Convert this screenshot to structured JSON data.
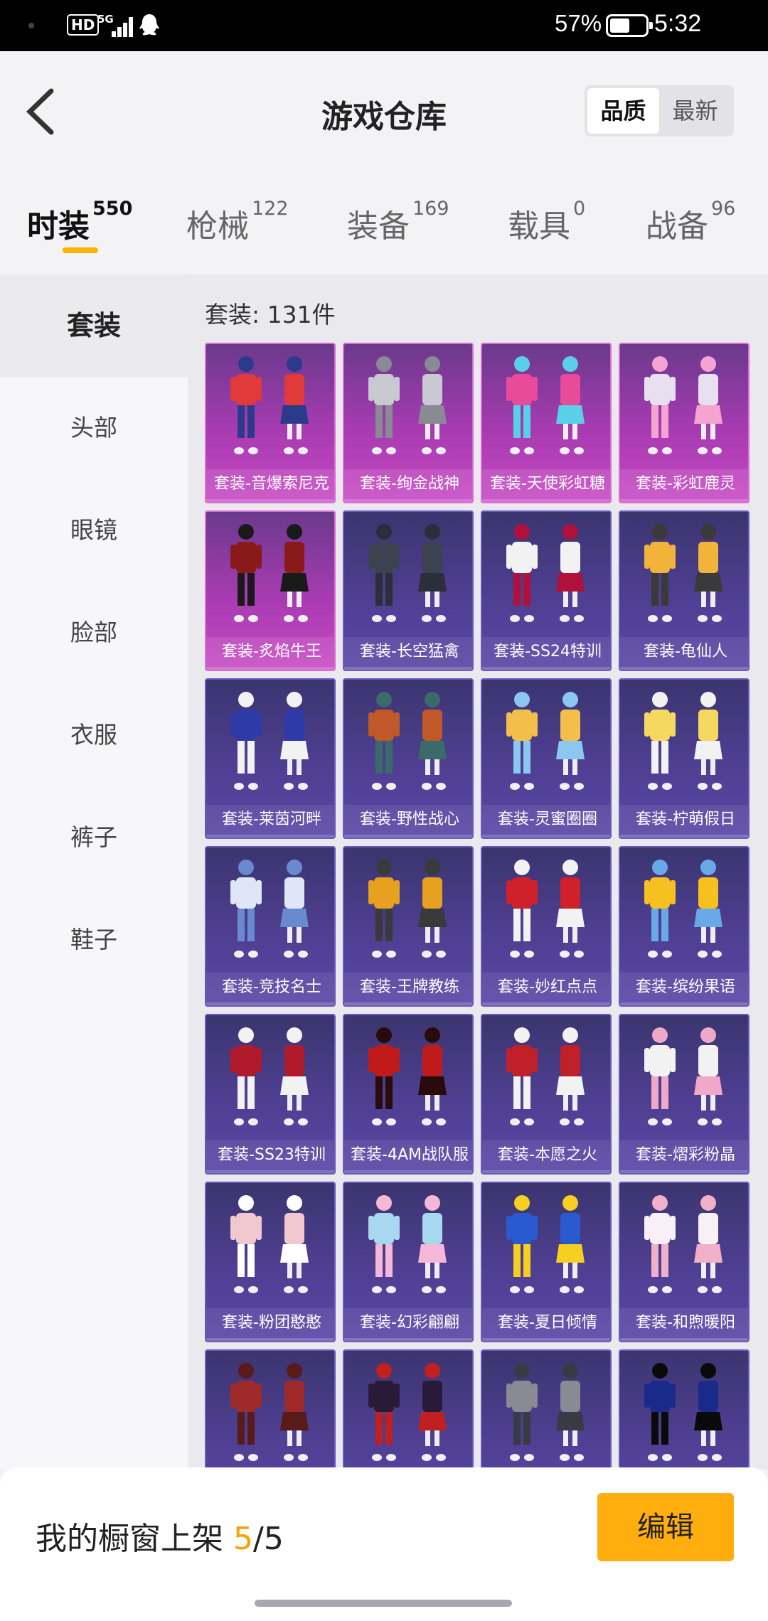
{
  "status_bar": {
    "hd": "HD",
    "network": "5G",
    "battery": "57%",
    "battery_level": 0.57,
    "time": "5:32"
  },
  "header": {
    "title": "游戏仓库",
    "sort_options": [
      "品质",
      "最新"
    ],
    "sort_selected": "品质"
  },
  "tabs": [
    {
      "label": "时装",
      "count": "550",
      "active": true
    },
    {
      "label": "枪械",
      "count": "122"
    },
    {
      "label": "装备",
      "count": "169"
    },
    {
      "label": "载具",
      "count": "0"
    },
    {
      "label": "战备",
      "count": "96"
    }
  ],
  "sidebar": {
    "items": [
      "套装",
      "头部",
      "眼镜",
      "脸部",
      "衣服",
      "裤子",
      "鞋子"
    ],
    "active": "套装"
  },
  "content": {
    "count_label": "套装: 131件",
    "items": [
      {
        "name": "套装-音爆索尼克",
        "rarity": "pink"
      },
      {
        "name": "套装-绚金战神",
        "rarity": "pink"
      },
      {
        "name": "套装-天使彩虹糖",
        "rarity": "pink"
      },
      {
        "name": "套装-彩虹鹿灵",
        "rarity": "pink"
      },
      {
        "name": "套装-炙焰牛王",
        "rarity": "pink"
      },
      {
        "name": "套装-长空猛禽",
        "rarity": "purple"
      },
      {
        "name": "套装-SS24特训",
        "rarity": "purple"
      },
      {
        "name": "套装-龟仙人",
        "rarity": "purple"
      },
      {
        "name": "套装-莱茵河畔",
        "rarity": "purple"
      },
      {
        "name": "套装-野性战心",
        "rarity": "purple"
      },
      {
        "name": "套装-灵蜜圈圈",
        "rarity": "purple"
      },
      {
        "name": "套装-柠萌假日",
        "rarity": "purple"
      },
      {
        "name": "套装-竞技名士",
        "rarity": "purple"
      },
      {
        "name": "套装-王牌教练",
        "rarity": "purple"
      },
      {
        "name": "套装-妙红点点",
        "rarity": "purple"
      },
      {
        "name": "套装-缤纷果语",
        "rarity": "purple"
      },
      {
        "name": "套装-SS23特训",
        "rarity": "purple"
      },
      {
        "name": "套装-4AM战队服",
        "rarity": "purple"
      },
      {
        "name": "套装-本愿之火",
        "rarity": "purple"
      },
      {
        "name": "套装-熠彩粉晶",
        "rarity": "purple"
      },
      {
        "name": "套装-粉团憨憨",
        "rarity": "purple"
      },
      {
        "name": "套装-幻彩翩翩",
        "rarity": "purple"
      },
      {
        "name": "套装-夏日倾情",
        "rarity": "purple"
      },
      {
        "name": "套装-和煦暖阳",
        "rarity": "purple"
      },
      {
        "name": "",
        "rarity": "purple"
      },
      {
        "name": "",
        "rarity": "purple"
      },
      {
        "name": "",
        "rarity": "purple"
      },
      {
        "name": "",
        "rarity": "purple"
      }
    ]
  },
  "bottom": {
    "window_prefix": "我的橱窗上架 ",
    "window_used": "5",
    "window_total": "/5",
    "edit_label": "编辑"
  },
  "colors": {
    "accent": "#ffae0d",
    "purple_card": "#4f3f92",
    "pink_card": "#a83bb1"
  }
}
